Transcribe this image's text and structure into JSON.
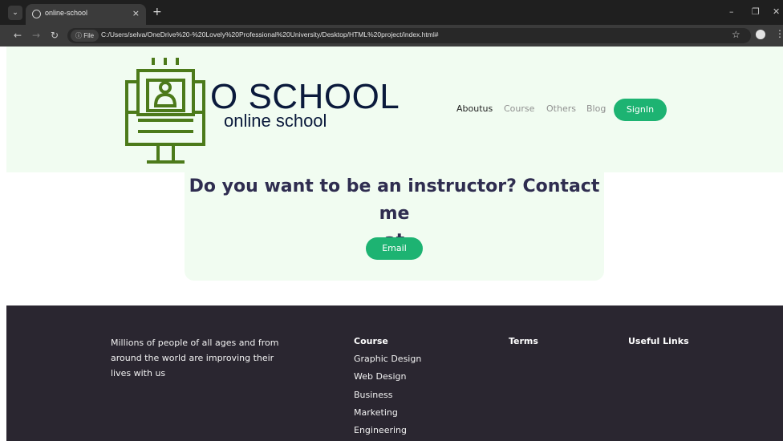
{
  "browser": {
    "tab_title": "online-school",
    "tab_close": "×",
    "new_tab": "+",
    "url_chip": "ⓘ File",
    "url": "C:/Users/selva/OneDrive%20-%20Lovely%20Professional%20University/Desktop/HTML%20project/index.html#",
    "icons": [
      "chevron-down-icon",
      "globe-icon",
      "back-icon",
      "forward-icon",
      "reload-icon",
      "info-icon",
      "star-icon",
      "profile-icon",
      "kebab-icon",
      "minimize-icon",
      "restore-icon",
      "close-icon"
    ]
  },
  "header": {
    "brand_title": "O SCHOOL",
    "brand_sub": "online school",
    "nav": [
      "Aboutus",
      "Course",
      "Others",
      "Blog"
    ],
    "signin": "SignIn"
  },
  "cta": {
    "heading_line1": "Do you want to be an instructor? Contact me",
    "heading_line2": "at",
    "button": "Email"
  },
  "footer": {
    "about": "Millions of people of all ages and from around the world are improving their lives with us",
    "course_heading": "Course",
    "course_links": [
      "Graphic Design",
      "Web Design",
      "Business",
      "Marketing",
      "Engineering"
    ],
    "terms_heading": "Terms",
    "useful_heading": "Useful Links"
  },
  "colors": {
    "accent_green": "#1db372",
    "logo_green": "#4c7a1a",
    "header_bg": "#f1fcf1",
    "footer_bg": "#2a2630",
    "heading_text": "#2f2d50"
  }
}
